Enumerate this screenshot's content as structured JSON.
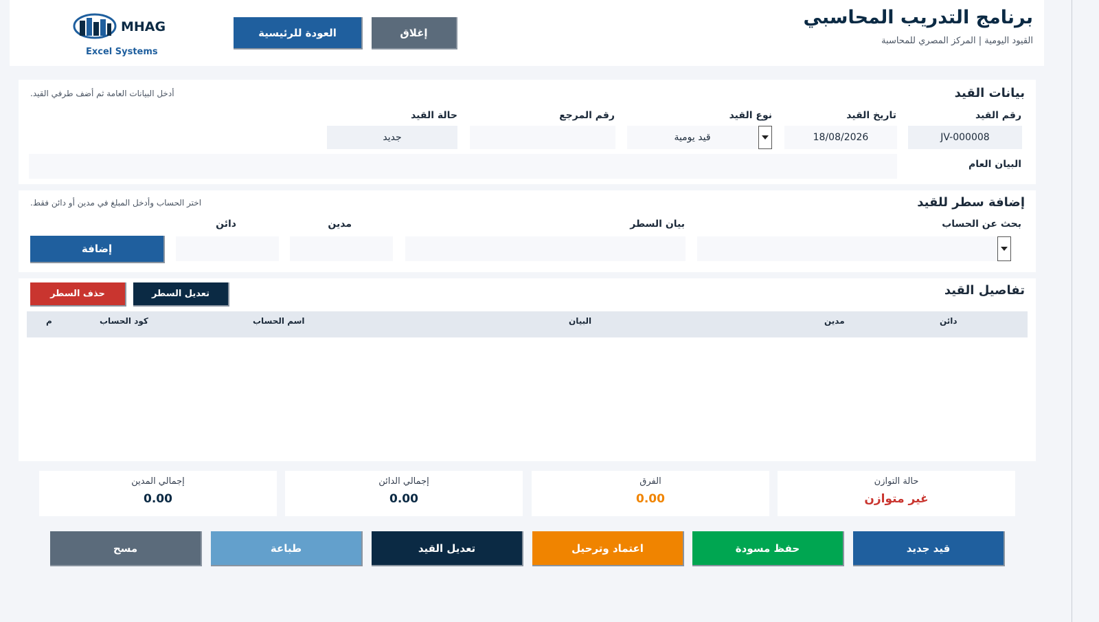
{
  "header": {
    "title": "برنامج التدريب المحاسبي",
    "subtitle": "القيود اليومية | المركز المصري للمحاسبة",
    "logo_text": "MHAG",
    "logo_sub": "Excel Systems",
    "home_button": "العودة للرئيسية",
    "close_button": "إغلاق"
  },
  "entry": {
    "title": "بيانات القيد",
    "hint": "أدخل البيانات العامة ثم أضف طرفي القيد.",
    "number_label": "رقم القيد",
    "number_value": "JV-000008",
    "date_label": "تاريخ القيد",
    "date_value": "18/08/2026",
    "type_label": "نوع القيد",
    "type_value": "قيد يومية",
    "ref_label": "رقم المرجع",
    "ref_value": "",
    "status_label": "حالة القيد",
    "status_value": "جديد",
    "desc_label": "البيان العام",
    "desc_value": ""
  },
  "line": {
    "title": "إضافة سطر للقيد",
    "hint": "اختر الحساب وأدخل المبلغ في مدين أو دائن فقط.",
    "account_label": "بحث عن الحساب",
    "desc_label": "بيان السطر",
    "debit_label": "مدين",
    "credit_label": "دائن",
    "add_button": "إضافة"
  },
  "details": {
    "title": "تفاصيل القيد",
    "edit_line_button": "تعديل السطر",
    "delete_line_button": "حذف السطر",
    "columns": {
      "credit": "دائن",
      "debit": "مدين",
      "desc": "البيان",
      "account_name": "اسم الحساب",
      "account_code": "كود الحساب",
      "index": "م"
    }
  },
  "totals": {
    "balance_label": "حالة التوازن",
    "balance_value": "غير متوازن",
    "diff_label": "الفرق",
    "diff_value": "0.00",
    "credit_label": "إجمالي الدائن",
    "credit_value": "0.00",
    "debit_label": "إجمالي المدين",
    "debit_value": "0.00"
  },
  "actions": {
    "new": "قيد جديد",
    "draft": "حفظ مسودة",
    "post": "اعتماد وترحيل",
    "edit": "تعديل القيد",
    "print": "طباعة",
    "clear": "مسح"
  },
  "colors": {
    "blue": "#1f5f9e",
    "gray": "#5b6b7b",
    "green": "#00a651",
    "orange": "#f08400",
    "navy": "#0b2a44",
    "light_blue": "#63a0cc",
    "red": "#c9352f"
  }
}
